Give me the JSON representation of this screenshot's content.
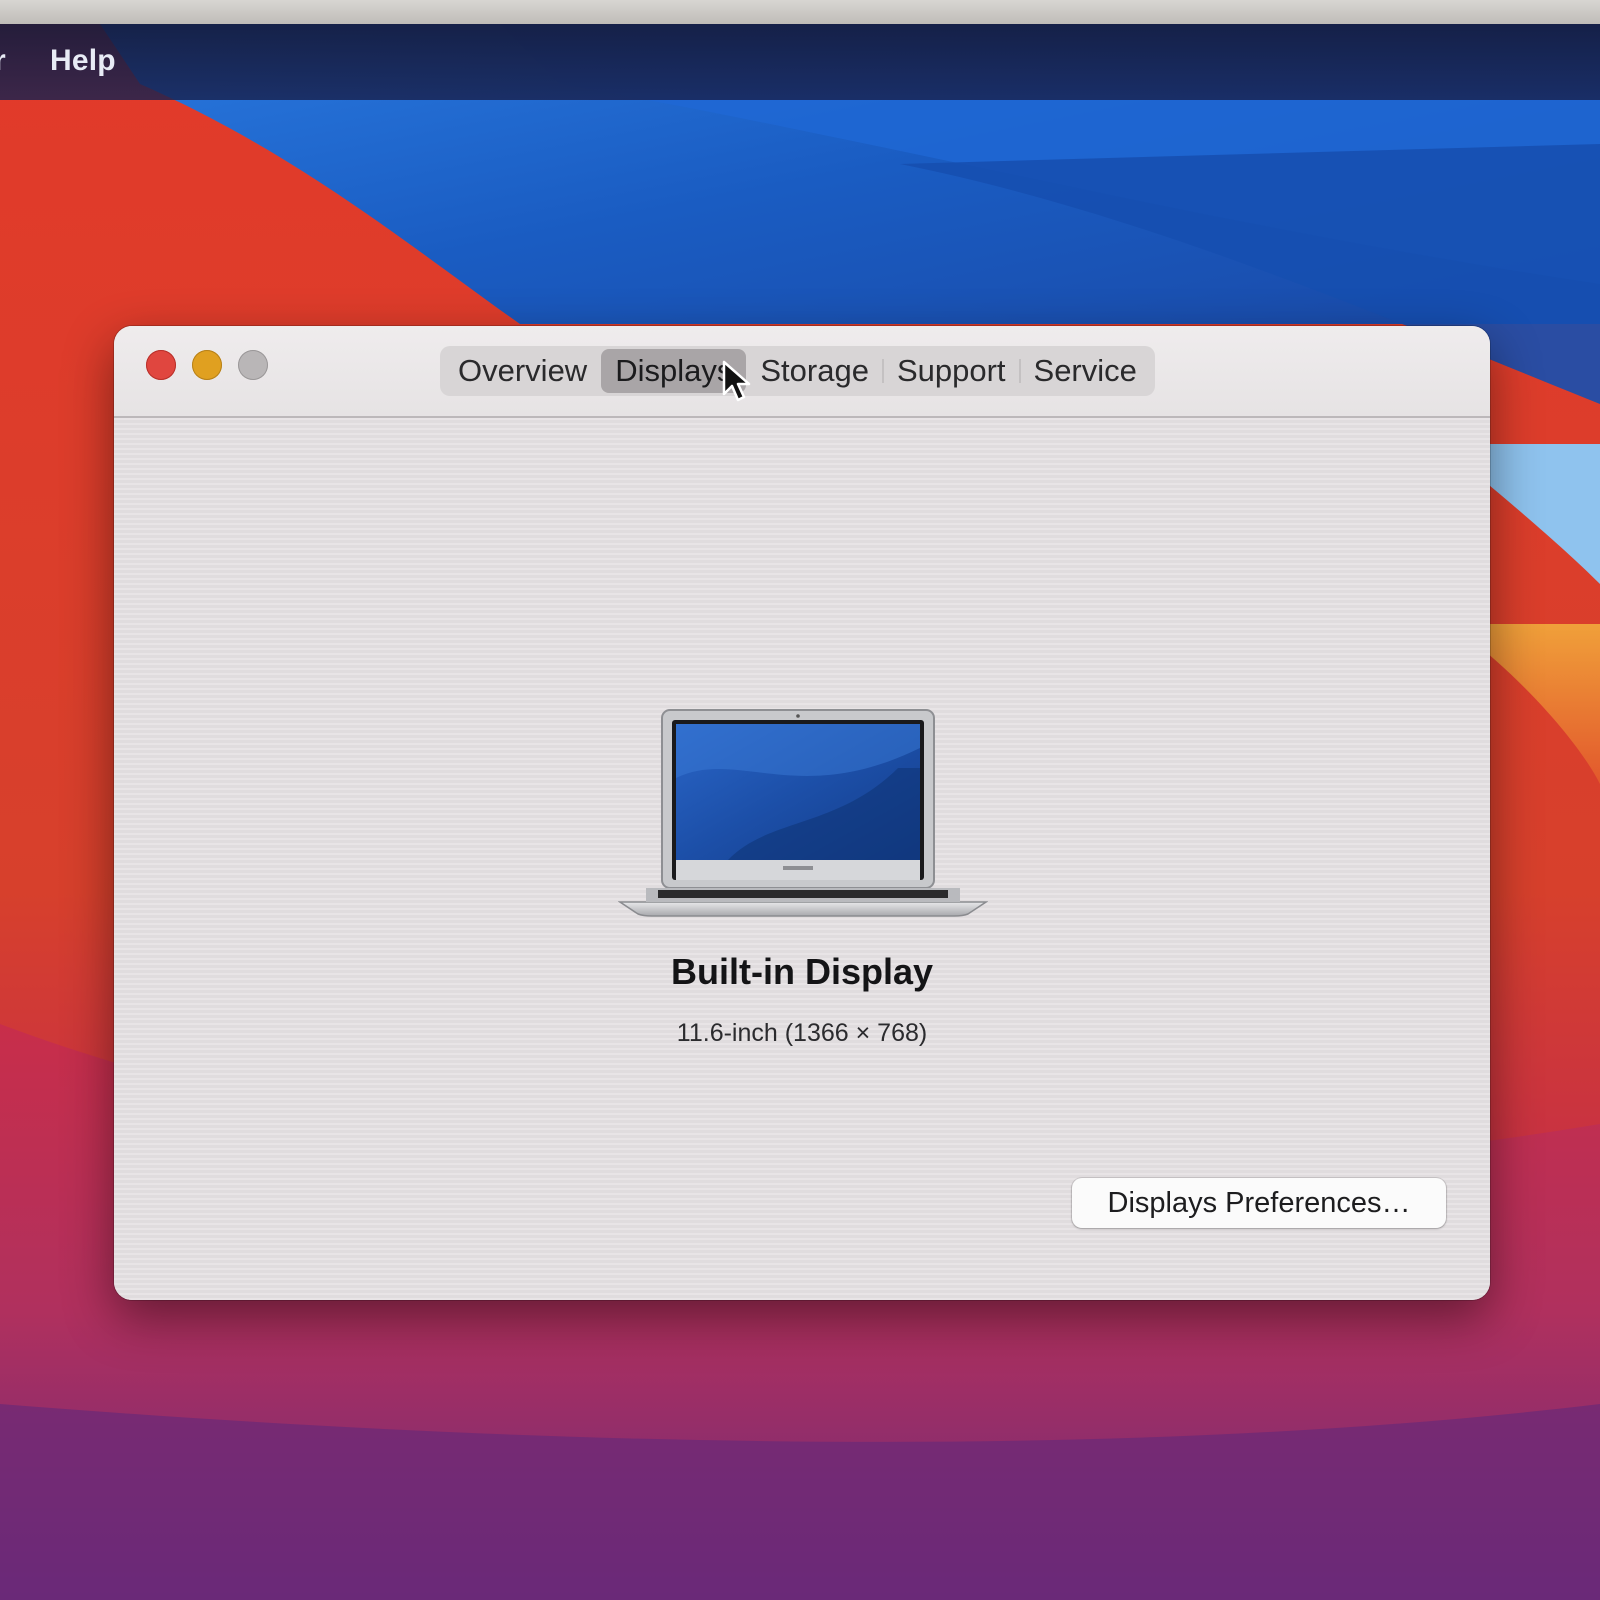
{
  "menubar": {
    "edge_fragment": "r",
    "help": "Help"
  },
  "window": {
    "traffic_lights": {
      "close_color": "#e0463f",
      "minimize_color": "#e0a020",
      "zoom_color": "#b9b6b7"
    },
    "tabs": [
      {
        "label": "Overview",
        "selected": false
      },
      {
        "label": "Displays",
        "selected": true
      },
      {
        "label": "Storage",
        "selected": false
      },
      {
        "label": "Support",
        "selected": false
      },
      {
        "label": "Service",
        "selected": false
      }
    ],
    "display": {
      "name": "Built-in Display",
      "spec": "11.6-inch (1366 × 768)"
    },
    "preferences_button": "Displays Preferences…"
  },
  "icons": {
    "laptop": "laptop-icon",
    "cursor": "arrow-cursor-icon"
  },
  "colors": {
    "wallpaper_red": "#e2402c",
    "wallpaper_blue": "#1b62c8",
    "wallpaper_magenta": "#b8305a",
    "window_bg": "#e6e2e4",
    "selected_tab": "#a9a5a7"
  }
}
